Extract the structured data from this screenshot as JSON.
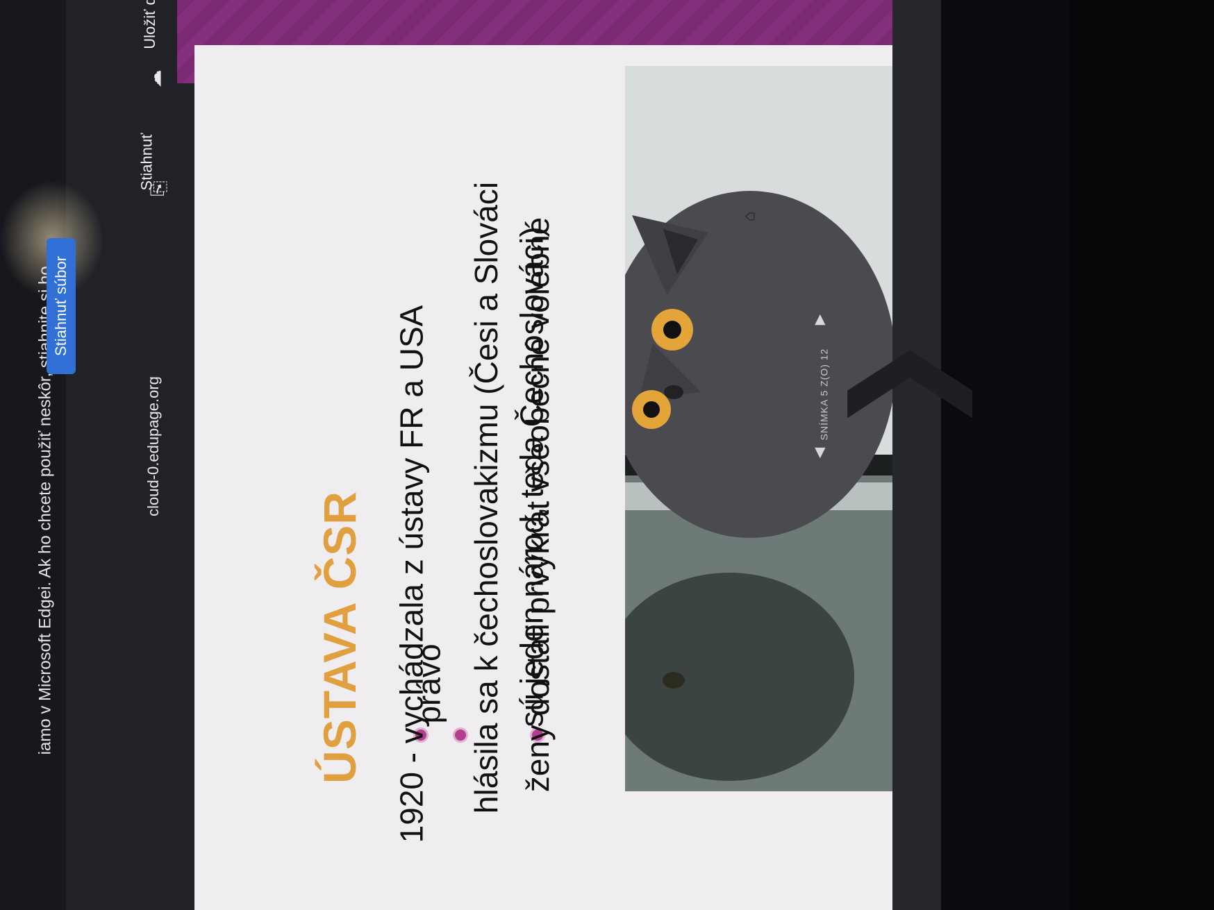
{
  "notification": {
    "text": "iamo v Microsoft Edgei. Ak ho chcete použiť neskôr, stiahnite si ho.",
    "download_button": "Stiahnuť súbor"
  },
  "address_bar": {
    "url": "cloud-0.edupage.org"
  },
  "toolbar": {
    "download_label": "Stiahnuť",
    "save_label": "Uložiť d"
  },
  "slide": {
    "title": "ÚSTAVA ČSR",
    "bullets": [
      {
        "lines": [
          "1920 - vychádzala z ústavy FR a USA"
        ]
      },
      {
        "lines": [
          "ženy dostali prvýkrát všeobecné volebné",
          "právo"
        ]
      },
      {
        "lines": [
          "hlásila sa k čechoslovakizmu (Česi a Slováci",
          "sú jeden národ, teda Čechoslováci)"
        ]
      }
    ],
    "bullet_color": "#b0408e",
    "title_color": "#e0a040"
  },
  "viewer": {
    "slide_counter": "SNÍMKA 5 Z(O) 12",
    "prev_symbol": "◀",
    "next_symbol": "▶"
  },
  "icons": {
    "download": "download-icon",
    "cloud": "cloud-icon",
    "cursor": "cursor-icon"
  }
}
